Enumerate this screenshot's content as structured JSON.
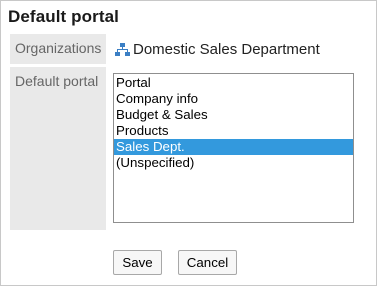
{
  "title": "Default portal",
  "fields": {
    "organizations_label": "Organizations",
    "organization_value": "Domestic Sales Department",
    "default_portal_label": "Default portal"
  },
  "portal_options": [
    {
      "label": "Portal",
      "selected": false
    },
    {
      "label": "Company info",
      "selected": false
    },
    {
      "label": "Budget & Sales",
      "selected": false
    },
    {
      "label": "Products",
      "selected": false
    },
    {
      "label": "Sales Dept.",
      "selected": true
    },
    {
      "label": "(Unspecified)",
      "selected": false
    }
  ],
  "buttons": {
    "save": "Save",
    "cancel": "Cancel"
  },
  "colors": {
    "selection": "#3399dd",
    "org_icon": "#3b7fc4",
    "label_bg": "#e9e9e9"
  },
  "icons": {
    "organization": "org-chart-icon"
  }
}
